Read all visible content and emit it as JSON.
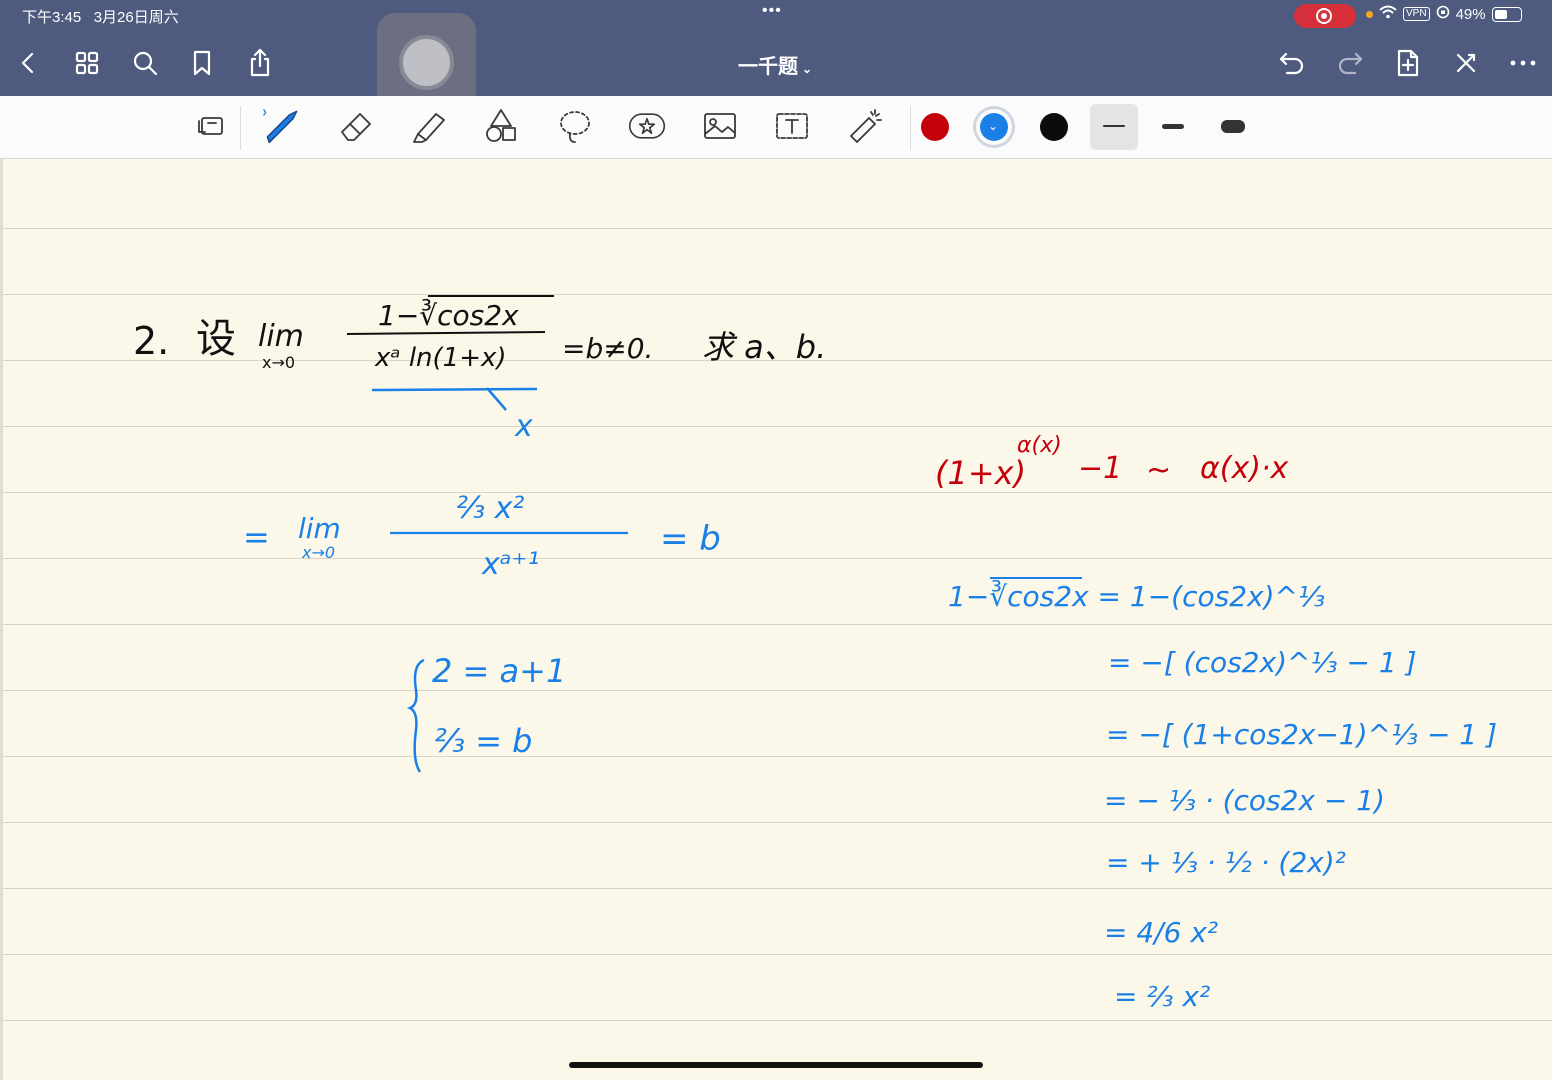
{
  "status_bar": {
    "time": "下午3:45",
    "date": "3月26日周六",
    "battery": "49%",
    "vpn": "VPN",
    "dots": "•••"
  },
  "nav": {
    "title": "一千题",
    "title_chevron": "⌄",
    "icons": [
      "back-icon",
      "grid-icon",
      "search-icon",
      "bookmark-icon",
      "share-icon",
      "undo-icon",
      "redo-icon",
      "add-page-icon",
      "close-icon",
      "more-icon"
    ]
  },
  "toolbar": {
    "tools": [
      "page-view-icon",
      "pen-icon",
      "eraser-icon",
      "highlighter-icon",
      "shapes-icon",
      "lasso-icon",
      "sticker-icon",
      "image-icon",
      "text-icon",
      "laser-icon"
    ],
    "colors": [
      "#c4000b",
      "#1a7fe6",
      "#0c0c0c"
    ],
    "selected_color": "#1a7fe6",
    "widths": [
      "thin",
      "medium",
      "thick"
    ],
    "selected_width": "thin"
  },
  "note": {
    "problem": {
      "number": "2.",
      "setup": "设",
      "lim": "lim",
      "sub": "x→0",
      "numerator": "1−∛cos2x",
      "denominator": "xᵃ ln(1+x)",
      "condition": "=b≠0.",
      "ask": "求 a、b."
    },
    "replacement": "x",
    "step1": {
      "eq": "=",
      "lim": "lim",
      "sub": "x→0",
      "numerator": "⅔ x²",
      "denominator": "xᵃ⁺¹",
      "result": "= b"
    },
    "system": [
      "2 = a+1",
      "⅔ = b"
    ],
    "formula": {
      "left": "(1+x)",
      "exp": "α(x)",
      "minus": "−1",
      "approx": "~",
      "right": "α(x)·x"
    },
    "derivation": [
      "1−∛cos2x  = 1−(cos2x)^⅓",
      "= −[ (cos2x)^⅓ − 1 ]",
      "= −[ (1+cos2x−1)^⅓ − 1 ]",
      "= − ⅓ · (cos2x − 1)",
      "= + ⅓ · ½ · (2x)²",
      "= 4/6 x²",
      "= ⅔ x²"
    ]
  }
}
